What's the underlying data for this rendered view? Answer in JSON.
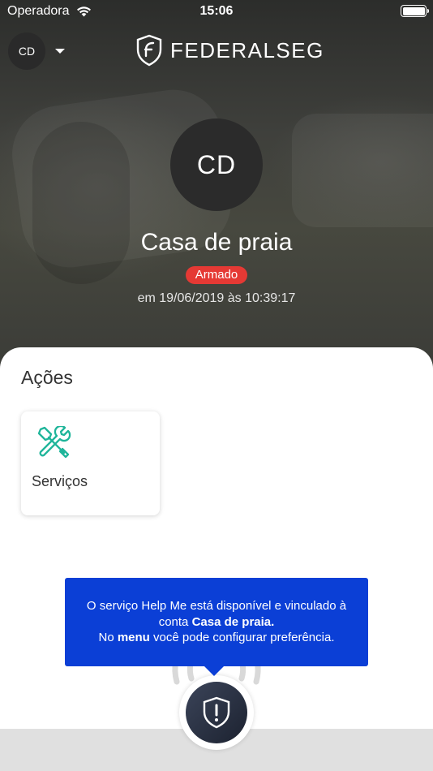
{
  "status_bar": {
    "carrier": "Operadora",
    "time": "15:06",
    "battery_level": 1.0
  },
  "header": {
    "account_initials": "CD",
    "brand_name": "FEDERALSEG"
  },
  "profile": {
    "initials": "CD",
    "name": "Casa de praia",
    "status": "Armado",
    "status_color": "#e53934",
    "timestamp": "em 19/06/2019 às 10:39:17"
  },
  "actions": {
    "title": "Ações",
    "items": [
      {
        "label": "Serviços",
        "icon": "tools-icon",
        "icon_color": "#1fb59a"
      }
    ]
  },
  "tooltip": {
    "line1": "O serviço Help Me está disponível e vinculado à",
    "line2_prefix": "conta ",
    "line2_bold": "Casa de praia.",
    "line3_prefix": "No ",
    "line3_bold": "menu",
    "line3_suffix": " você pode configurar preferência.",
    "background": "#0b3fd6"
  },
  "helpme": {
    "icon": "shield-alert-icon"
  }
}
